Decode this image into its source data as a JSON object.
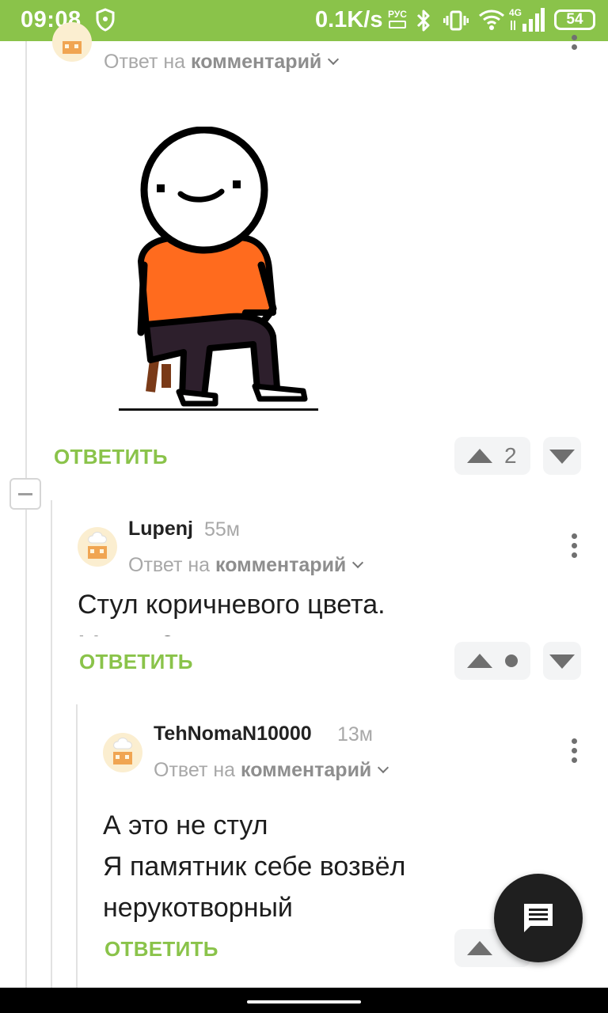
{
  "status_bar": {
    "time": "09:08",
    "speed": "0.1K/s",
    "lang": "РУС",
    "network": "4G",
    "battery": "54",
    "color": "#8ac34a"
  },
  "comments": [
    {
      "reply_prefix": "Ответ на",
      "reply_target": "комментарий",
      "image": "sitting-stick-figure-meme",
      "reply_label": "ОТВЕТИТЬ",
      "votes": "2"
    },
    {
      "author": "Lupenj",
      "time": "55м",
      "reply_prefix": "Ответ на",
      "reply_target": "комментарий",
      "text_line1": "Стул коричневого цвета.",
      "text_line2": "М... ... ?",
      "reply_label": "ОТВЕТИТЬ"
    },
    {
      "author": "TehNomaN10000",
      "time": "13м",
      "reply_prefix": "Ответ на",
      "reply_target": "комментарий",
      "text_line1": "А это не стул",
      "text_line2": "Я памятник себе возвёл",
      "text_line3": "нерукотворный",
      "reply_label": "ОТВЕТИТЬ"
    }
  ],
  "accent_color": "#8ac34a",
  "fab_icon": "comment-icon"
}
